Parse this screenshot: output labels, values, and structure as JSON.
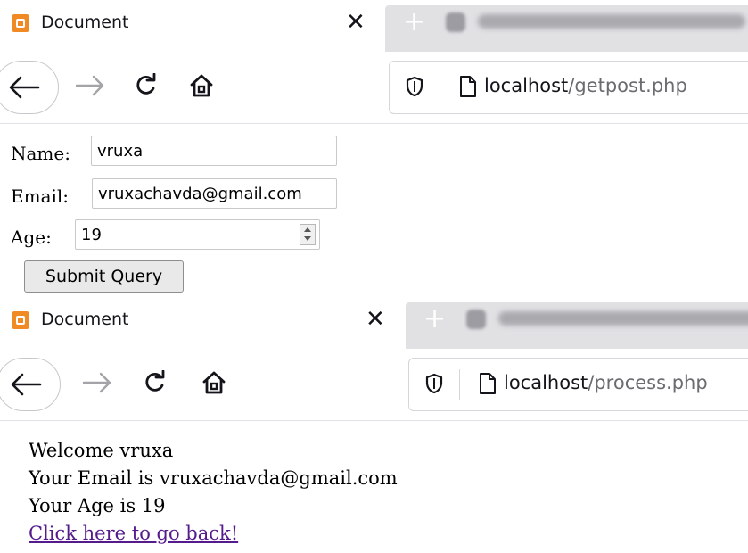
{
  "screens": [
    {
      "tab": {
        "title": "Document",
        "close_glyph": "✕"
      },
      "url": {
        "host": "localhost",
        "path": "/getpost.php"
      },
      "form": {
        "name_label": "Name:",
        "name_value": "vruxa",
        "email_label": "Email:",
        "email_value": "vruxachavda@gmail.com",
        "age_label": "Age:",
        "age_value": "19",
        "submit_label": "Submit Query"
      }
    },
    {
      "tab": {
        "title": "Document",
        "close_glyph": "✕"
      },
      "url": {
        "host": "localhost",
        "path": "/process.php"
      },
      "result": {
        "welcome": "Welcome vruxa",
        "email_line": "Your Email is vruxachavda@gmail.com",
        "age_line": "Your Age is 19",
        "back_link": "Click here to go back!"
      }
    }
  ],
  "icons": {
    "favicon": "xampp-favicon-icon",
    "new_tab": "plus-icon",
    "back": "arrow-left-icon",
    "forward": "arrow-right-icon",
    "reload": "reload-icon",
    "home": "home-icon",
    "tracking": "shield-icon",
    "page": "page-icon"
  },
  "colors": {
    "favicon": "#f08a24",
    "visited_link": "#551a8b",
    "inactive_tab": "#e1e1e4"
  }
}
